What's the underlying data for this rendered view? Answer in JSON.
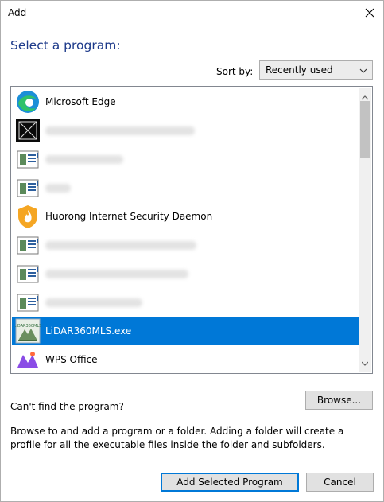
{
  "window": {
    "title": "Add"
  },
  "heading": "Select a program:",
  "sort": {
    "label": "Sort by:",
    "value": "Recently used"
  },
  "programs": [
    {
      "label": "Microsoft Edge",
      "icon": "edge-icon"
    },
    {
      "label": "",
      "icon": "blank-app-icon"
    },
    {
      "label": "",
      "icon": "generic-app-icon"
    },
    {
      "label": "",
      "icon": "generic-app-icon"
    },
    {
      "label": "Huorong Internet Security Daemon",
      "icon": "huorong-shield-icon"
    },
    {
      "label": "",
      "icon": "generic-app-icon"
    },
    {
      "label": "",
      "icon": "generic-app-icon"
    },
    {
      "label": "",
      "icon": "generic-app-icon"
    },
    {
      "label": "LiDAR360MLS.exe",
      "icon": "lidar360mls-icon",
      "selected": true
    },
    {
      "label": "WPS Office",
      "icon": "wps-office-icon"
    }
  ],
  "cant_find": "Can't find the program?",
  "browse_button": "Browse...",
  "description": "Browse to and add a program or a folder. Adding a folder will create a profile for all the executable files inside the folder and subfolders.",
  "add_button": "Add Selected Program",
  "cancel_button": "Cancel",
  "colors": {
    "selection": "#0078d7",
    "heading": "#1d3a8a"
  }
}
